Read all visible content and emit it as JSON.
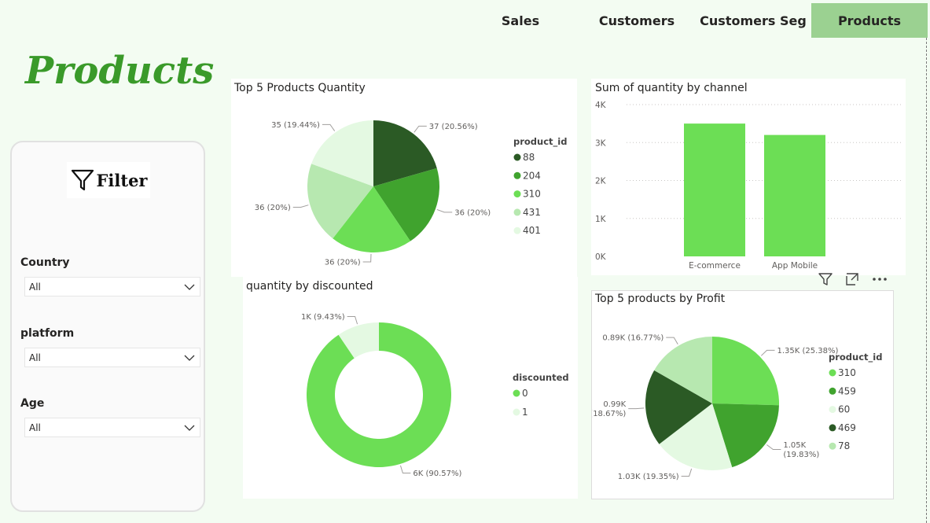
{
  "nav": {
    "tabs": [
      {
        "label": "Sales",
        "active": false
      },
      {
        "label": "Customers",
        "active": false
      },
      {
        "label": "Customers Seg",
        "active": false
      },
      {
        "label": "Products",
        "active": true
      }
    ]
  },
  "page": {
    "title": "Products"
  },
  "filter": {
    "title": "Filter",
    "icon": "funnel-icon",
    "slicers": [
      {
        "label": "Country",
        "value": "All"
      },
      {
        "label": "platform",
        "value": "All"
      },
      {
        "label": "Age",
        "value": "All"
      }
    ]
  },
  "colors": {
    "accent": "#3a9a2a",
    "tab_active": "#9bd191",
    "bar": "#6cde55",
    "c88": "#2b5a25",
    "c204": "#40a32e",
    "c310": "#6cde55",
    "c431": "#b7e8b0",
    "c401": "#e4f9e2"
  },
  "chart_data": [
    {
      "type": "pie",
      "title": "Top 5 Products Quantity",
      "legend_title": "product_id",
      "legend_position": "right",
      "categories": [
        "88",
        "204",
        "310",
        "431",
        "401"
      ],
      "values": [
        37,
        36,
        36,
        36,
        35
      ],
      "data_labels": [
        "37 (20.56%)",
        "36 (20%)",
        "36 (20%)",
        "36 (20%)",
        "35 (19.44%)"
      ]
    },
    {
      "type": "bar",
      "title": "Sum of quantity by channel",
      "categories": [
        "E-commerce",
        "App Mobile"
      ],
      "values": [
        3500,
        3200
      ],
      "ylim": [
        0,
        4000
      ],
      "yticks": [
        "0K",
        "1K",
        "2K",
        "3K",
        "4K"
      ],
      "grid": true
    },
    {
      "type": "pie",
      "subtype": "donut",
      "title": "quantity by discounted",
      "legend_title": "discounted",
      "legend_position": "right",
      "categories": [
        "0",
        "1"
      ],
      "values": [
        6000,
        625
      ],
      "data_labels": [
        "6K (90.57%)",
        "1K (9.43%)"
      ]
    },
    {
      "type": "pie",
      "title": "Top 5 products by Profit",
      "legend_title": "product_id",
      "legend_position": "right",
      "categories": [
        "310",
        "459",
        "60",
        "469",
        "78"
      ],
      "values": [
        1350,
        1050,
        1030,
        990,
        890
      ],
      "data_labels": [
        "1.35K (25.38%)",
        "1.05K (19.83%)",
        "1.03K (19.35%)",
        "0.99K (18.67%)",
        "0.89K (16.77%)"
      ]
    }
  ]
}
